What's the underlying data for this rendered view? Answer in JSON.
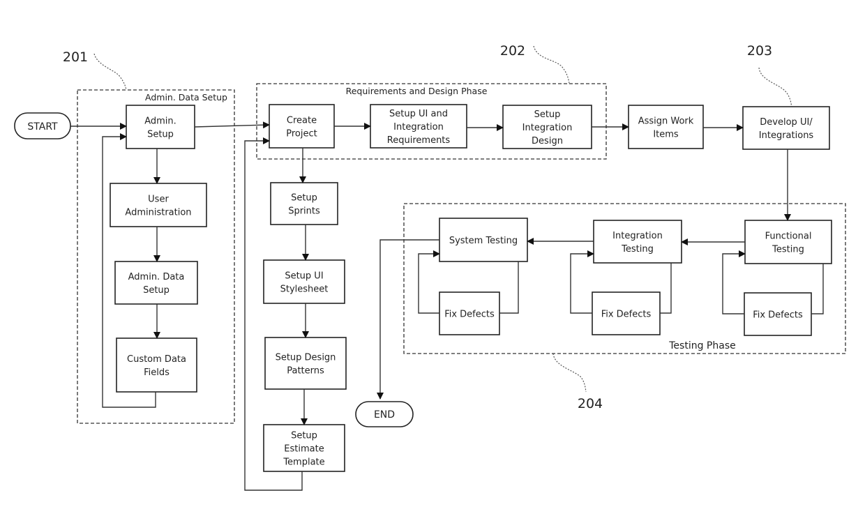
{
  "diagram": {
    "terminals": {
      "start": "START",
      "end": "END"
    },
    "groups": {
      "admin": {
        "label": "Admin. Data Setup",
        "ref": "201"
      },
      "requirements": {
        "label": "Requirements and Design Phase",
        "ref": "202"
      },
      "develop": {
        "ref": "203"
      },
      "testing": {
        "label": "Testing Phase",
        "ref": "204"
      }
    },
    "nodes": {
      "admin_setup": [
        "Admin.",
        "Setup"
      ],
      "user_admin": [
        "User",
        "Administration"
      ],
      "admin_data_setup": [
        "Admin. Data",
        "Setup"
      ],
      "custom_fields": [
        "Custom Data",
        "Fields"
      ],
      "create_project": [
        "Create",
        "Project"
      ],
      "setup_ui_req": [
        "Setup UI and",
        "Integration",
        "Requirements"
      ],
      "setup_int_design": [
        "Setup",
        "Integration",
        "Design"
      ],
      "assign_work": [
        "Assign Work",
        "Items"
      ],
      "develop_ui": [
        "Develop UI/",
        "Integrations"
      ],
      "setup_sprints": [
        "Setup",
        "Sprints"
      ],
      "setup_stylesheet": [
        "Setup UI",
        "Stylesheet"
      ],
      "setup_patterns": [
        "Setup Design",
        "Patterns"
      ],
      "setup_estimate": [
        "Setup",
        "Estimate",
        "Template"
      ],
      "system_testing": [
        "System Testing"
      ],
      "integration_testing": [
        "Integration",
        "Testing"
      ],
      "functional_testing": [
        "Functional",
        "Testing"
      ],
      "fix_defects_1": [
        "Fix Defects"
      ],
      "fix_defects_2": [
        "Fix Defects"
      ],
      "fix_defects_3": [
        "Fix Defects"
      ]
    }
  }
}
